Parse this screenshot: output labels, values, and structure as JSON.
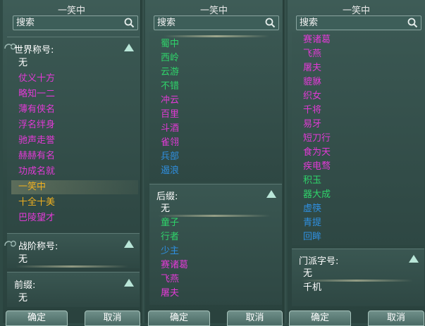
{
  "panels": [
    {
      "title": "一笑中",
      "search_placeholder": "搜索",
      "sections": [
        {
          "header": "世界称号:",
          "items": [
            {
              "label": "无",
              "color": "#ffffff"
            },
            {
              "label": "仗义十方",
              "color": "#e23ad6"
            },
            {
              "label": "略知一二",
              "color": "#e23ad6"
            },
            {
              "label": "薄有侠名",
              "color": "#e23ad6"
            },
            {
              "label": "浮名绊身",
              "color": "#e23ad6"
            },
            {
              "label": "驰声走誉",
              "color": "#e23ad6"
            },
            {
              "label": "赫赫有名",
              "color": "#e23ad6"
            },
            {
              "label": "功成名就",
              "color": "#e23ad6"
            },
            {
              "label": "一笑中",
              "color": "#f0b020",
              "selected": true
            },
            {
              "label": "十全十美",
              "color": "#f0b020"
            },
            {
              "label": "巴陵望才",
              "color": "#e23ad6"
            }
          ]
        },
        {
          "header": "战阶称号:",
          "items": [
            {
              "label": "无",
              "color": "#ffffff"
            }
          ]
        },
        {
          "header": "前缀:",
          "items": [
            {
              "label": "无",
              "color": "#ffffff"
            }
          ]
        }
      ],
      "buttons": {
        "ok": "确定",
        "cancel": "取消"
      }
    },
    {
      "title": "一笑中",
      "search_placeholder": "搜索",
      "sections": [
        {
          "header": "",
          "items": [
            {
              "label": "蜀中",
              "color": "#2fd46a"
            },
            {
              "label": "西岭",
              "color": "#2fd46a"
            },
            {
              "label": "云游",
              "color": "#2fd46a"
            },
            {
              "label": "不错",
              "color": "#2fd46a"
            },
            {
              "label": "冲云",
              "color": "#e23ad6"
            },
            {
              "label": "百里",
              "color": "#e23ad6"
            },
            {
              "label": "斗酒",
              "color": "#e23ad6"
            },
            {
              "label": "雀翎",
              "color": "#e23ad6"
            },
            {
              "label": "兵部",
              "color": "#2f8fe0"
            },
            {
              "label": "遏浪",
              "color": "#2f8fe0"
            }
          ]
        },
        {
          "header": "后缀:",
          "items": [
            {
              "label": "无",
              "color": "#ffffff"
            },
            {
              "label": "童子",
              "color": "#2fd46a"
            },
            {
              "label": "行者",
              "color": "#2fd46a"
            },
            {
              "label": "少主",
              "color": "#2f8fe0"
            },
            {
              "label": "赛诸葛",
              "color": "#e23ad6"
            },
            {
              "label": "飞燕",
              "color": "#e23ad6"
            },
            {
              "label": "屠夫",
              "color": "#e23ad6"
            }
          ]
        }
      ],
      "buttons": {
        "ok": "确定",
        "cancel": "取消"
      }
    },
    {
      "title": "一笑中",
      "search_placeholder": "搜索",
      "sections": [
        {
          "header": "",
          "items": [
            {
              "label": "赛诸葛",
              "color": "#e23ad6"
            },
            {
              "label": "飞燕",
              "color": "#e23ad6"
            },
            {
              "label": "屠夫",
              "color": "#e23ad6"
            },
            {
              "label": "貔貅",
              "color": "#e23ad6"
            },
            {
              "label": "织女",
              "color": "#e23ad6"
            },
            {
              "label": "千将",
              "color": "#e23ad6"
            },
            {
              "label": "易牙",
              "color": "#e23ad6"
            },
            {
              "label": "短刀行",
              "color": "#e23ad6"
            },
            {
              "label": "食为天",
              "color": "#e23ad6"
            },
            {
              "label": "疾电骛",
              "color": "#e23ad6"
            },
            {
              "label": "积玉",
              "color": "#2fd46a"
            },
            {
              "label": "器大成",
              "color": "#2fd46a"
            },
            {
              "label": "虚筷",
              "color": "#2f8fe0"
            },
            {
              "label": "青提",
              "color": "#2f8fe0"
            },
            {
              "label": "回眸",
              "color": "#2f8fe0"
            }
          ]
        },
        {
          "header": "门派字号:",
          "items": [
            {
              "label": "无",
              "color": "#ffffff"
            },
            {
              "label": "千机",
              "color": "#ffffff"
            }
          ]
        }
      ],
      "buttons": {
        "ok": "确定",
        "cancel": "取消"
      }
    }
  ]
}
